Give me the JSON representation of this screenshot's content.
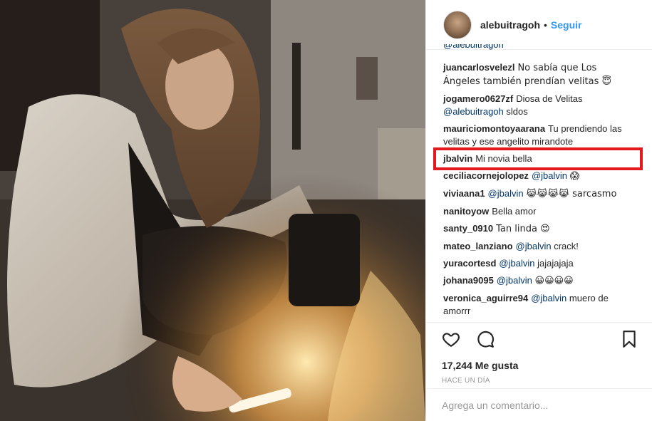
{
  "header": {
    "username": "alebuitragoh",
    "separator": "•",
    "follow_label": "Seguir"
  },
  "comments": [
    {
      "user": "",
      "text": "@alebuitragoh",
      "partial": true
    },
    {
      "user": "juancarlosvelezl",
      "text": "No sabía que Los Ángeles también prendían velitas 😇"
    },
    {
      "user": "jogamero0627zf",
      "text": "Diosa de Velitas",
      "mention_after": "@alebuitragoh",
      "text_after": " sldos"
    },
    {
      "user": "mauriciomontoyaarana",
      "text": "Tu prendiendo las velitas y ese angelito mirandote"
    },
    {
      "user": "jbalvin",
      "text": "Mi novia bella",
      "highlighted": true
    },
    {
      "user": "ceciliacornejolopez",
      "mention": "@jbalvin",
      "text": "😱"
    },
    {
      "user": "viviaana1",
      "mention": "@jbalvin",
      "text": "😹😹😹😹 sarcasmo"
    },
    {
      "user": "nanitoyow",
      "text": "Bella amor"
    },
    {
      "user": "santy_0910",
      "text": "Tan linda 😍"
    },
    {
      "user": "mateo_lanziano",
      "mention": "@jbalvin",
      "text": "crack!"
    },
    {
      "user": "yuracortesd",
      "mention": "@jbalvin",
      "text": "jajajajaja"
    },
    {
      "user": "johana9095",
      "mention": "@jbalvin",
      "text": "😀😀😀😀"
    },
    {
      "user": "veronica_aguirre94",
      "mention": "@jbalvin",
      "text": "muero de amorrr"
    }
  ],
  "actions": {
    "likes_text": "17,244 Me gusta",
    "time_text": "HACE UN DÍA",
    "comment_placeholder": "Agrega un comentario..."
  },
  "colors": {
    "accent": "#3897f0",
    "highlight_box": "#e3191f",
    "mention": "#003569"
  },
  "icons": [
    "heart-icon",
    "comment-icon",
    "bookmark-icon"
  ]
}
